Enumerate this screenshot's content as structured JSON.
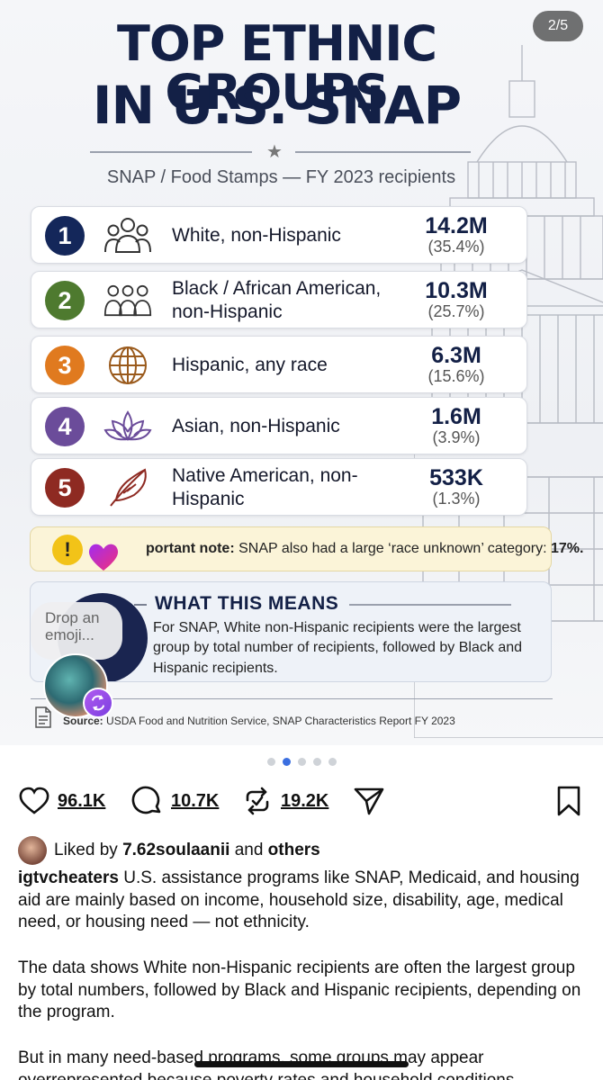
{
  "post": {
    "carousel_counter": "2/5",
    "infographic": {
      "title_line1": "TOP ETHNIC GROUPS",
      "title_line2": "IN U.S. SNAP",
      "subtitle": "SNAP / Food Stamps — FY 2023 recipients",
      "rows": [
        {
          "rank": "1",
          "label": "White, non-Hispanic",
          "value": "14.2M",
          "pct": "(35.4%)",
          "color": "#14275a",
          "icon": "people-group-icon"
        },
        {
          "rank": "2",
          "label": "Black / African American, non-Hispanic",
          "value": "10.3M",
          "pct": "(25.7%)",
          "color": "#4e7a2f",
          "icon": "people-group-icon"
        },
        {
          "rank": "3",
          "label": "Hispanic, any race",
          "value": "6.3M",
          "pct": "(15.6%)",
          "color": "#e07a1f",
          "icon": "globe-icon"
        },
        {
          "rank": "4",
          "label": "Asian, non-Hispanic",
          "value": "1.6M",
          "pct": "(3.9%)",
          "color": "#6b4c9a",
          "icon": "lotus-icon"
        },
        {
          "rank": "5",
          "label": "Native American, non-Hispanic",
          "value": "533K",
          "pct": "(1.3%)",
          "color": "#8e2a22",
          "icon": "feather-icon"
        }
      ],
      "note_icon": "!",
      "note_label": "portant note:",
      "note_text": "SNAP also had a large ‘race unknown’ category:",
      "note_value": "17%.",
      "means_title": "WHAT THIS MEANS",
      "means_body": "For SNAP, White non-Hispanic recipients were the largest group by total number of recipients, followed by Black and Hispanic recipients.",
      "source_label": "Source:",
      "source_text": "USDA Food and Nutrition Service, SNAP Characteristics Report FY 2023"
    },
    "overlay": {
      "drop_emoji_text": "Drop an emoji..."
    }
  },
  "actions": {
    "likes": "96.1K",
    "comments": "10.7K",
    "reposts": "19.2K"
  },
  "liked_by": {
    "prefix": "Liked by",
    "user": "7.62soulaanii",
    "and": "and",
    "others": "others"
  },
  "caption": {
    "username": "igtvcheaters",
    "p1": "U.S. assistance programs like SNAP, Medicaid, and housing aid are mainly based on income, household size, disability, age, medical need, or housing need — not ethnicity.",
    "p2": "The data shows White non-Hispanic recipients are often the largest group by total numbers, followed by Black and Hispanic recipients, depending on the program.",
    "p3": "But in many need-based programs, some groups may appear overrepresented because poverty rates and household conditions"
  }
}
